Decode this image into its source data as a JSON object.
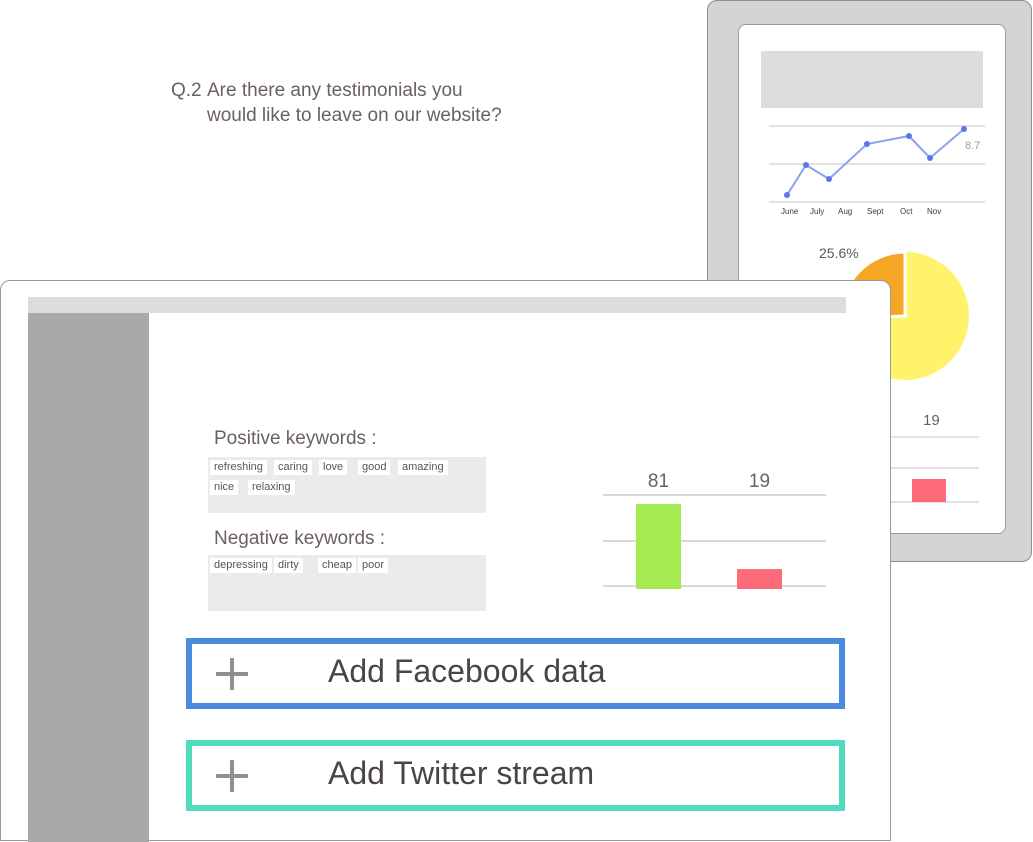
{
  "tablet": {
    "line_chart": {
      "months": [
        "June",
        "July",
        "Aug",
        "Sept",
        "Oct",
        "Nov"
      ],
      "end_label": "8.7",
      "color": "#8aa2f0",
      "dot_color": "#5c76e8"
    },
    "pie": {
      "label": "25.6%",
      "colors": [
        "#f5a623",
        "#fff36b"
      ]
    },
    "bar_label": "19",
    "bar_color": "#fd6b7b"
  },
  "question": {
    "number": "Q.2",
    "line1": "Are there any testimonials you",
    "line2": "would like to leave on our website?"
  },
  "positive": {
    "heading": "Positive keywords :",
    "keywords": [
      "refreshing",
      "caring",
      "love",
      "good",
      "amazing",
      "nice",
      "relaxing"
    ]
  },
  "negative": {
    "heading": "Negative keywords :",
    "keywords": [
      "depressing",
      "dirty",
      "cheap",
      "poor"
    ]
  },
  "chart_data": {
    "type": "bar",
    "categories": [
      "",
      ""
    ],
    "values": [
      81,
      19
    ],
    "colors": [
      "#a3eb50",
      "#fd6b7b"
    ]
  },
  "buttons": {
    "facebook_label": "Add Facebook data",
    "twitter_label": "Add Twitter stream"
  }
}
